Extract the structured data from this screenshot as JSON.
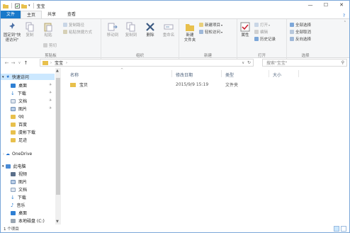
{
  "window": {
    "title": "宝宝",
    "buttons": {
      "minimize": "—",
      "maximize": "☐",
      "close": "✕"
    }
  },
  "tabs": [
    {
      "label": "文件"
    },
    {
      "label": "主页"
    },
    {
      "label": "共享"
    },
    {
      "label": "查看"
    }
  ],
  "help_icon": "?",
  "ribbon": {
    "clipboard": {
      "group_label": "剪贴板",
      "pin_label": "固定到\"快\n速访问\"",
      "copy_label": "复制",
      "paste_label": "粘贴",
      "copy_path": "复制路径",
      "paste_shortcut": "粘贴快捷方式",
      "cut": "剪切"
    },
    "organize": {
      "group_label": "组织",
      "move_to": "移动到",
      "copy_to": "复制到",
      "delete": "删除",
      "rename": "重命名"
    },
    "new": {
      "group_label": "新建",
      "new_folder": "新建\n文件夹",
      "new_item": "新建项目",
      "easy_access": "轻松访问"
    },
    "open": {
      "group_label": "打开",
      "properties": "属性",
      "open": "打开",
      "edit": "编辑",
      "history": "历史记录"
    },
    "select": {
      "group_label": "选择",
      "select_all": "全部选择",
      "select_none": "全部取消",
      "invert": "反向选择"
    }
  },
  "address": {
    "crumb": "宝宝",
    "search_placeholder": "搜索\"宝宝\""
  },
  "nav": {
    "quick_access": "快速访问",
    "items": [
      {
        "label": "桌面",
        "pinned": true
      },
      {
        "label": "下载",
        "pinned": true
      },
      {
        "label": "文档",
        "pinned": true
      },
      {
        "label": "图片",
        "pinned": true
      },
      {
        "label": "qq",
        "pinned": false
      },
      {
        "label": "百度",
        "pinned": false
      },
      {
        "label": "虞彬下载",
        "pinned": false
      },
      {
        "label": "足迹",
        "pinned": false
      }
    ],
    "onedrive": "OneDrive",
    "this_pc": "此电脑",
    "pc_items": [
      {
        "label": "视频"
      },
      {
        "label": "图片"
      },
      {
        "label": "文档"
      },
      {
        "label": "下载"
      },
      {
        "label": "音乐"
      },
      {
        "label": "桌面"
      },
      {
        "label": "本地磁盘 (C:)"
      }
    ]
  },
  "columns": {
    "name": "名称",
    "date": "修改日期",
    "type": "类型",
    "size": "大小"
  },
  "files": [
    {
      "name": "宝贝",
      "date": "2015/9/9 15:19",
      "type": "文件夹",
      "size": ""
    }
  ],
  "status": {
    "text": "1 个项目"
  },
  "colors": {
    "accent": "#1979ca",
    "folder": "#e8c04c",
    "selection": "#cce8ff"
  }
}
